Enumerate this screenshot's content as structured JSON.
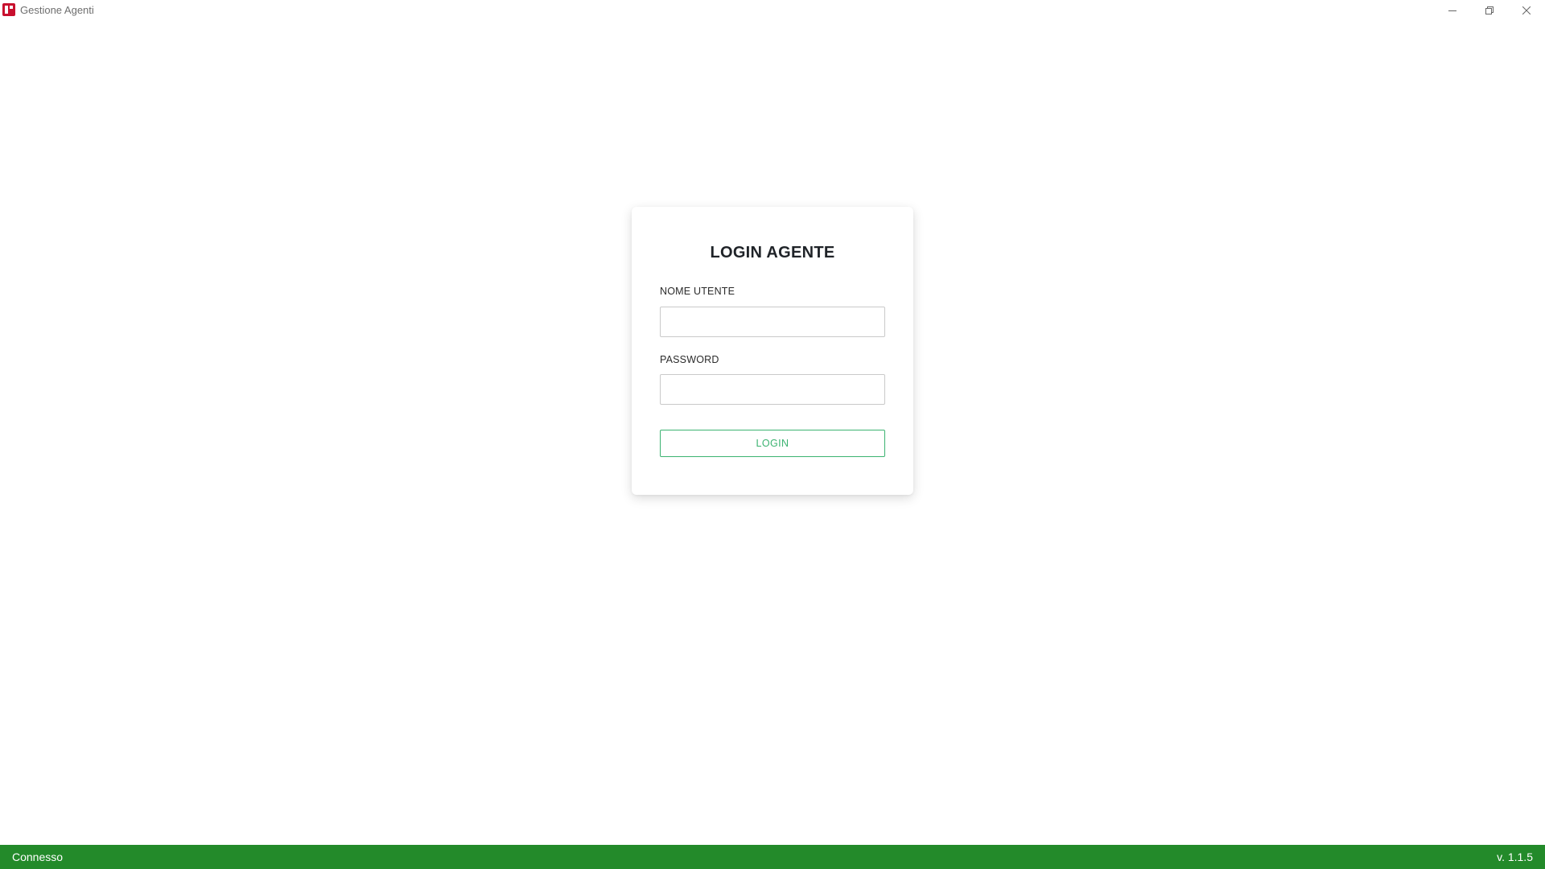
{
  "window": {
    "title": "Gestione Agenti",
    "icon": "app-logo-icon",
    "controls": {
      "minimize": "minimize-icon",
      "restore": "restore-icon",
      "close": "close-icon"
    }
  },
  "login": {
    "title": "LOGIN AGENTE",
    "username_label": "NOME UTENTE",
    "username_value": "",
    "password_label": "PASSWORD",
    "password_value": "",
    "button_label": "LOGIN"
  },
  "status_bar": {
    "status": "Connesso",
    "version": "v. 1.1.5"
  },
  "colors": {
    "status_bar_bg": "#238a2a",
    "accent_green": "#3cb371",
    "app_icon": "#c8102e"
  }
}
